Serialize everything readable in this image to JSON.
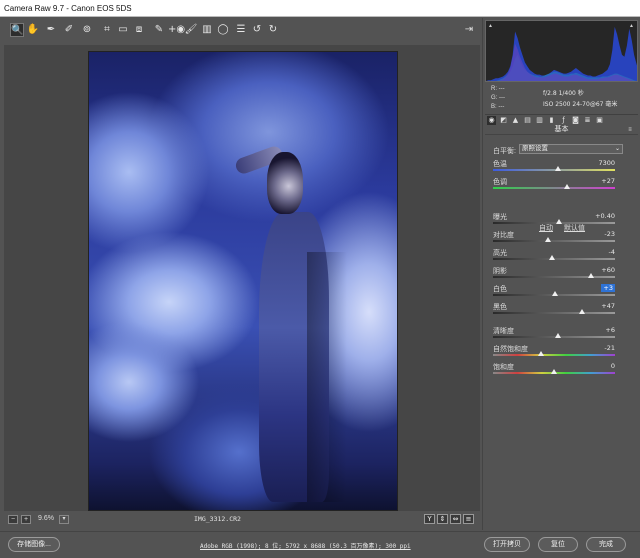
{
  "window": {
    "title": "Camera Raw 9.7 -  Canon EOS 5DS"
  },
  "toolbar": {
    "tools": [
      {
        "name": "zoom-tool-icon",
        "glyph": "🔍",
        "active": true
      },
      {
        "name": "hand-tool-icon",
        "glyph": "✋"
      },
      {
        "name": "white-balance-tool-icon",
        "glyph": "✒"
      },
      {
        "name": "color-sampler-tool-icon",
        "glyph": "✐"
      },
      {
        "name": "targeted-adjustment-tool-icon",
        "glyph": "⊚"
      },
      {
        "name": "crop-tool-icon",
        "glyph": "⌗"
      },
      {
        "name": "straighten-tool-icon",
        "glyph": "▭"
      },
      {
        "name": "transform-tool-icon",
        "glyph": "⧈"
      },
      {
        "name": "spot-removal-tool-icon",
        "glyph": "✎"
      },
      {
        "name": "red-eye-tool-icon",
        "glyph": "+◉"
      },
      {
        "name": "adjustment-brush-icon",
        "glyph": "🖌"
      },
      {
        "name": "graduated-filter-icon",
        "glyph": "▥"
      },
      {
        "name": "radial-filter-icon",
        "glyph": "◯"
      },
      {
        "name": "preferences-icon",
        "glyph": "☰"
      },
      {
        "name": "rotate-ccw-icon",
        "glyph": "↺"
      },
      {
        "name": "rotate-cw-icon",
        "glyph": "↻"
      }
    ],
    "export_glyph": "⇥"
  },
  "readout": {
    "r": "R:",
    "g": "G:",
    "b": "B:",
    "r_val": "---",
    "g_val": "---",
    "b_val": "---",
    "info_line1": "f/2.8   1/400 秒",
    "info_line2": "ISO 2500   24-70@67 毫米"
  },
  "panel": {
    "title": "基本",
    "wb_label": "白平衡:",
    "wb_value": "原照设置",
    "auto": "自动",
    "default": "默认值",
    "sliders_top": [
      {
        "label": "色温",
        "value": "7300",
        "pos": 0.53,
        "track": "temp"
      },
      {
        "label": "色调",
        "value": "+27",
        "pos": 0.61,
        "track": "tint"
      }
    ],
    "sliders_mid": [
      {
        "label": "曝光",
        "value": "+0.40",
        "pos": 0.54,
        "track": "gray"
      },
      {
        "label": "对比度",
        "value": "-23",
        "pos": 0.45,
        "track": "gray"
      },
      {
        "label": "高光",
        "value": "-4",
        "pos": 0.48,
        "track": "gray"
      },
      {
        "label": "阴影",
        "value": "+60",
        "pos": 0.8,
        "track": "gray"
      },
      {
        "label": "白色",
        "value": "+3",
        "pos": 0.51,
        "track": "gray",
        "selected": true
      },
      {
        "label": "黑色",
        "value": "+47",
        "pos": 0.73,
        "track": "gray"
      }
    ],
    "sliders_bottom": [
      {
        "label": "清晰度",
        "value": "+6",
        "pos": 0.53,
        "track": "gray"
      },
      {
        "label": "自然饱和度",
        "value": "-21",
        "pos": 0.39,
        "track": "vib"
      },
      {
        "label": "饱和度",
        "value": "0",
        "pos": 0.5,
        "track": "sat"
      }
    ]
  },
  "status": {
    "zoom": "9.6%",
    "filename": "IMG_3312.CR2",
    "view_buttons": [
      "Y",
      "⇕",
      "⇔",
      "≡"
    ]
  },
  "bottom": {
    "save": "存储图像...",
    "workflow": "Adobe RGB (1998); 8 位; 5792 x 8688 (50.3 百万像素); 300 ppi",
    "open": "打开拷贝",
    "reset": "复位",
    "done": "完成"
  },
  "histogram": {
    "blue": [
      2,
      3,
      3,
      4,
      5,
      5,
      6,
      7,
      9,
      12,
      18,
      30,
      55,
      48,
      38,
      30,
      22,
      18,
      14,
      12,
      10,
      9,
      9,
      8,
      8,
      9,
      10,
      12,
      14,
      13,
      12,
      11,
      10,
      10,
      11,
      12,
      14,
      16,
      14,
      12,
      10,
      9,
      8,
      8,
      7,
      7,
      8,
      9,
      10,
      12,
      14,
      20,
      35,
      60,
      52,
      40,
      30,
      28,
      40,
      58,
      46,
      30,
      20,
      12
    ],
    "red": [
      0,
      0,
      0,
      1,
      1,
      2,
      3,
      4,
      6,
      10,
      16,
      28,
      42,
      36,
      28,
      22,
      16,
      12,
      10,
      8,
      7,
      6,
      6,
      6,
      6,
      7,
      8,
      9,
      10,
      10,
      9,
      8,
      7,
      7,
      7,
      8,
      9,
      9,
      8,
      7,
      6,
      5,
      4,
      4,
      4,
      4,
      4,
      5,
      5,
      6,
      6,
      7,
      8,
      9,
      9,
      8,
      7,
      6,
      5,
      4,
      3,
      2,
      1,
      0
    ],
    "green": [
      0,
      0,
      1,
      1,
      2,
      3,
      4,
      5,
      7,
      9,
      12,
      18,
      26,
      30,
      24,
      18,
      14,
      12,
      10,
      9,
      8,
      8,
      7,
      7,
      8,
      9,
      10,
      11,
      12,
      12,
      11,
      10,
      9,
      9,
      9,
      10,
      10,
      11,
      10,
      9,
      8,
      7,
      6,
      6,
      6,
      6,
      6,
      6,
      7,
      7,
      7,
      8,
      9,
      10,
      10,
      9,
      8,
      7,
      6,
      5,
      4,
      3,
      2,
      1
    ]
  },
  "colors": {
    "accent": "#2f73d6",
    "panel_bg": "#535353",
    "photo_tint": "#3a50b4"
  }
}
